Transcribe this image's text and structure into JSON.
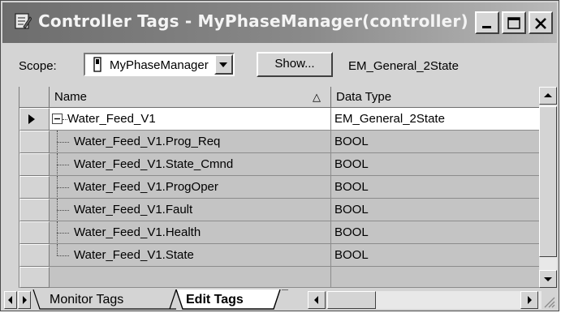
{
  "window": {
    "title": "Controller Tags - MyPhaseManager(controller)",
    "icon": "tags-window-icon",
    "buttons": [
      "minimize-icon",
      "maximize-icon",
      "close-icon"
    ]
  },
  "scope": {
    "label": "Scope:",
    "selected": "MyPhaseManager",
    "show_button": "Show...",
    "type_text": "EM_General_2State"
  },
  "table": {
    "columns": [
      "Name",
      "Data Type"
    ],
    "sort_indicator": "△",
    "rows": [
      {
        "name": "Water_Feed_V1",
        "type": "EM_General_2State",
        "expanded": true,
        "current": true
      },
      {
        "name": "Water_Feed_V1.Prog_Req",
        "type": "BOOL"
      },
      {
        "name": "Water_Feed_V1.State_Cmnd",
        "type": "BOOL"
      },
      {
        "name": "Water_Feed_V1.ProgOper",
        "type": "BOOL"
      },
      {
        "name": "Water_Feed_V1.Fault",
        "type": "BOOL"
      },
      {
        "name": "Water_Feed_V1.Health",
        "type": "BOOL"
      },
      {
        "name": "Water_Feed_V1.State",
        "type": "BOOL"
      }
    ]
  },
  "tabs": [
    {
      "label": "Monitor Tags",
      "active": false
    },
    {
      "label": "Edit Tags",
      "active": true
    }
  ],
  "colors": {
    "title_gradient_left": "#6d6d6d",
    "title_gradient_right": "#b9b9b9",
    "child_row_bg": "#c4c4c4",
    "parent_row_bg": "#ffffff"
  }
}
